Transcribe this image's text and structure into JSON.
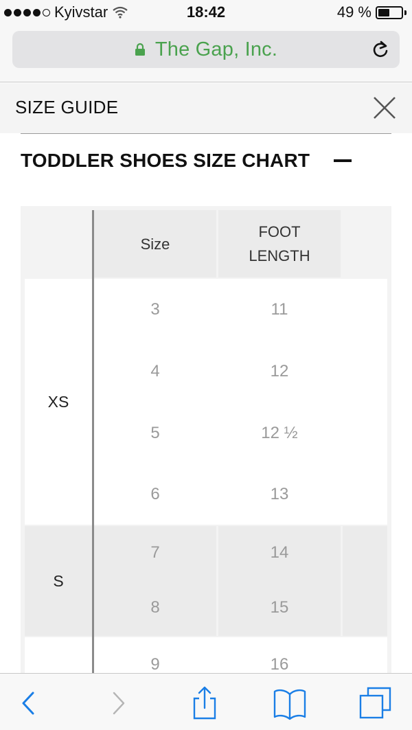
{
  "status_bar": {
    "carrier": "Kyivstar",
    "time": "18:42",
    "battery": "49 %",
    "battery_level": 0.49
  },
  "browser": {
    "url_title": "The Gap, Inc.",
    "icons": [
      "lock-icon",
      "reload-icon"
    ]
  },
  "header": {
    "title": "SIZE GUIDE",
    "close_icon": "close-icon"
  },
  "section": {
    "title": "TODDLER SHOES SIZE CHART",
    "toggle_symbol": "−"
  },
  "table": {
    "headers": {
      "group": "",
      "size": "Size",
      "foot_length_1": "FOOT",
      "foot_length_2": "LENGTH"
    },
    "groups": [
      {
        "label": "XS",
        "rows": [
          {
            "size": "3",
            "foot": "11"
          },
          {
            "size": "4",
            "foot": "12"
          },
          {
            "size": "5",
            "foot": "12 ½"
          },
          {
            "size": "6",
            "foot": "13"
          }
        ]
      },
      {
        "label": "S",
        "rows": [
          {
            "size": "7",
            "foot": "14"
          },
          {
            "size": "8",
            "foot": "15"
          }
        ]
      },
      {
        "label": "",
        "rows": [
          {
            "size": "9",
            "foot": "16"
          }
        ]
      }
    ]
  },
  "toolbar": {
    "icons": [
      "back-icon",
      "forward-icon",
      "share-icon",
      "bookmarks-icon",
      "tabs-icon"
    ]
  }
}
